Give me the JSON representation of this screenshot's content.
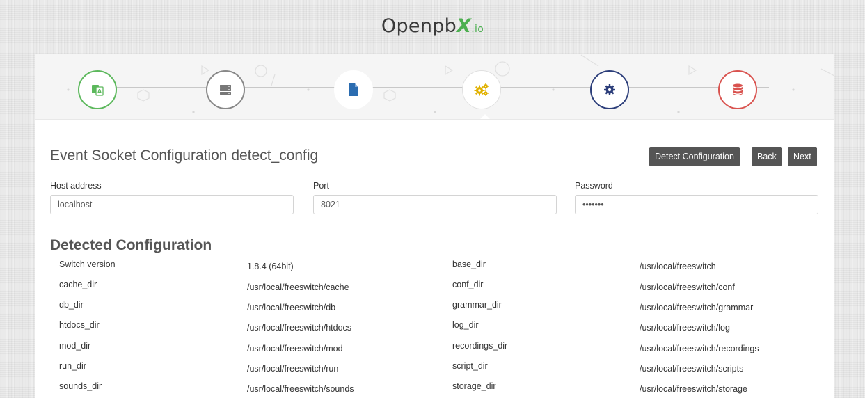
{
  "brand": {
    "name_prefix": "Openpb",
    "name_x": "X",
    "name_suffix": ".io"
  },
  "stepper": {
    "steps": [
      {
        "icon": "language-icon",
        "color": "#5cb85c",
        "state": "done"
      },
      {
        "icon": "server-icon",
        "color": "#888888",
        "state": "done"
      },
      {
        "icon": "file-icon",
        "color": "#2b6cb0",
        "state": "done"
      },
      {
        "icon": "cogs-icon",
        "color": "#e0b100",
        "state": "active"
      },
      {
        "icon": "gear-icon",
        "color": "#2c3e7a",
        "state": "pending"
      },
      {
        "icon": "database-icon",
        "color": "#d9534f",
        "state": "pending"
      }
    ]
  },
  "form": {
    "title": "Event Socket Configuration detect_config",
    "buttons": {
      "detect": "Detect Configuration",
      "back": "Back",
      "next": "Next"
    },
    "host": {
      "label": "Host address",
      "value": "localhost"
    },
    "port": {
      "label": "Port",
      "value": "8021"
    },
    "password": {
      "label": "Password",
      "value": "•••••••"
    }
  },
  "detected": {
    "title": "Detected Configuration",
    "left": [
      {
        "key": "Switch version",
        "value": "1.8.4 (64bit)"
      },
      {
        "key": "cache_dir",
        "value": "/usr/local/freeswitch/cache"
      },
      {
        "key": "db_dir",
        "value": "/usr/local/freeswitch/db"
      },
      {
        "key": "htdocs_dir",
        "value": "/usr/local/freeswitch/htdocs"
      },
      {
        "key": "mod_dir",
        "value": "/usr/local/freeswitch/mod"
      },
      {
        "key": "run_dir",
        "value": "/usr/local/freeswitch/run"
      },
      {
        "key": "sounds_dir",
        "value": "/usr/local/freeswitch/sounds"
      }
    ],
    "right": [
      {
        "key": "base_dir",
        "value": "/usr/local/freeswitch"
      },
      {
        "key": "conf_dir",
        "value": "/usr/local/freeswitch/conf"
      },
      {
        "key": "grammar_dir",
        "value": "/usr/local/freeswitch/grammar"
      },
      {
        "key": "log_dir",
        "value": "/usr/local/freeswitch/log"
      },
      {
        "key": "recordings_dir",
        "value": "/usr/local/freeswitch/recordings"
      },
      {
        "key": "script_dir",
        "value": "/usr/local/freeswitch/scripts"
      },
      {
        "key": "storage_dir",
        "value": "/usr/local/freeswitch/storage"
      }
    ]
  }
}
